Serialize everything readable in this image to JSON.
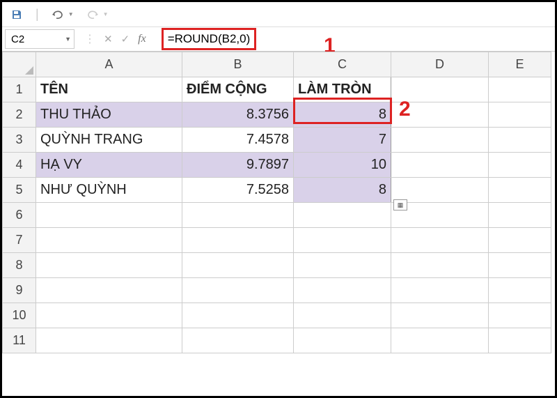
{
  "toolbar": {
    "save_title": "Save",
    "undo_title": "Undo",
    "redo_title": "Redo"
  },
  "formula_bar": {
    "cell_ref": "C2",
    "cancel": "✕",
    "enter": "✓",
    "fx": "fx",
    "formula": "=ROUND(B2,0)"
  },
  "callouts": {
    "one": "1",
    "two": "2"
  },
  "columns": [
    "A",
    "B",
    "C",
    "D",
    "E"
  ],
  "rows": [
    "1",
    "2",
    "3",
    "4",
    "5",
    "6",
    "7",
    "8",
    "9",
    "10",
    "11"
  ],
  "headers": {
    "A": "TÊN",
    "B": "ĐIỂM CỘNG",
    "C": "LÀM TRÒN"
  },
  "data": [
    {
      "ten": "THU THẢO",
      "diem": "8.3756",
      "tron": "8"
    },
    {
      "ten": "QUỲNH TRANG",
      "diem": "7.4578",
      "tron": "7"
    },
    {
      "ten": "HẠ VY",
      "diem": "9.7897",
      "tron": "10"
    },
    {
      "ten": "NHƯ QUỲNH",
      "diem": "7.5258",
      "tron": "8"
    }
  ]
}
